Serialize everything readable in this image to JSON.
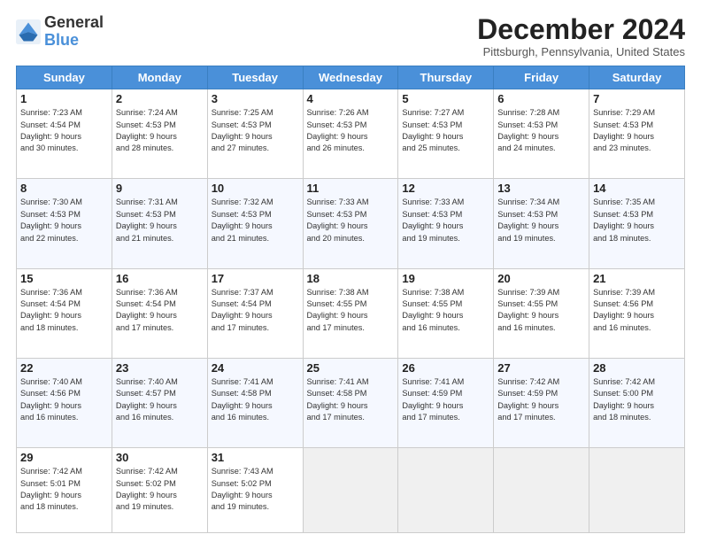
{
  "logo": {
    "text1": "General",
    "text2": "Blue"
  },
  "title": "December 2024",
  "location": "Pittsburgh, Pennsylvania, United States",
  "days_of_week": [
    "Sunday",
    "Monday",
    "Tuesday",
    "Wednesday",
    "Thursday",
    "Friday",
    "Saturday"
  ],
  "weeks": [
    [
      {
        "day": "1",
        "info": "Sunrise: 7:23 AM\nSunset: 4:54 PM\nDaylight: 9 hours\nand 30 minutes."
      },
      {
        "day": "2",
        "info": "Sunrise: 7:24 AM\nSunset: 4:53 PM\nDaylight: 9 hours\nand 28 minutes."
      },
      {
        "day": "3",
        "info": "Sunrise: 7:25 AM\nSunset: 4:53 PM\nDaylight: 9 hours\nand 27 minutes."
      },
      {
        "day": "4",
        "info": "Sunrise: 7:26 AM\nSunset: 4:53 PM\nDaylight: 9 hours\nand 26 minutes."
      },
      {
        "day": "5",
        "info": "Sunrise: 7:27 AM\nSunset: 4:53 PM\nDaylight: 9 hours\nand 25 minutes."
      },
      {
        "day": "6",
        "info": "Sunrise: 7:28 AM\nSunset: 4:53 PM\nDaylight: 9 hours\nand 24 minutes."
      },
      {
        "day": "7",
        "info": "Sunrise: 7:29 AM\nSunset: 4:53 PM\nDaylight: 9 hours\nand 23 minutes."
      }
    ],
    [
      {
        "day": "8",
        "info": "Sunrise: 7:30 AM\nSunset: 4:53 PM\nDaylight: 9 hours\nand 22 minutes."
      },
      {
        "day": "9",
        "info": "Sunrise: 7:31 AM\nSunset: 4:53 PM\nDaylight: 9 hours\nand 21 minutes."
      },
      {
        "day": "10",
        "info": "Sunrise: 7:32 AM\nSunset: 4:53 PM\nDaylight: 9 hours\nand 21 minutes."
      },
      {
        "day": "11",
        "info": "Sunrise: 7:33 AM\nSunset: 4:53 PM\nDaylight: 9 hours\nand 20 minutes."
      },
      {
        "day": "12",
        "info": "Sunrise: 7:33 AM\nSunset: 4:53 PM\nDaylight: 9 hours\nand 19 minutes."
      },
      {
        "day": "13",
        "info": "Sunrise: 7:34 AM\nSunset: 4:53 PM\nDaylight: 9 hours\nand 19 minutes."
      },
      {
        "day": "14",
        "info": "Sunrise: 7:35 AM\nSunset: 4:53 PM\nDaylight: 9 hours\nand 18 minutes."
      }
    ],
    [
      {
        "day": "15",
        "info": "Sunrise: 7:36 AM\nSunset: 4:54 PM\nDaylight: 9 hours\nand 18 minutes."
      },
      {
        "day": "16",
        "info": "Sunrise: 7:36 AM\nSunset: 4:54 PM\nDaylight: 9 hours\nand 17 minutes."
      },
      {
        "day": "17",
        "info": "Sunrise: 7:37 AM\nSunset: 4:54 PM\nDaylight: 9 hours\nand 17 minutes."
      },
      {
        "day": "18",
        "info": "Sunrise: 7:38 AM\nSunset: 4:55 PM\nDaylight: 9 hours\nand 17 minutes."
      },
      {
        "day": "19",
        "info": "Sunrise: 7:38 AM\nSunset: 4:55 PM\nDaylight: 9 hours\nand 16 minutes."
      },
      {
        "day": "20",
        "info": "Sunrise: 7:39 AM\nSunset: 4:55 PM\nDaylight: 9 hours\nand 16 minutes."
      },
      {
        "day": "21",
        "info": "Sunrise: 7:39 AM\nSunset: 4:56 PM\nDaylight: 9 hours\nand 16 minutes."
      }
    ],
    [
      {
        "day": "22",
        "info": "Sunrise: 7:40 AM\nSunset: 4:56 PM\nDaylight: 9 hours\nand 16 minutes."
      },
      {
        "day": "23",
        "info": "Sunrise: 7:40 AM\nSunset: 4:57 PM\nDaylight: 9 hours\nand 16 minutes."
      },
      {
        "day": "24",
        "info": "Sunrise: 7:41 AM\nSunset: 4:58 PM\nDaylight: 9 hours\nand 16 minutes."
      },
      {
        "day": "25",
        "info": "Sunrise: 7:41 AM\nSunset: 4:58 PM\nDaylight: 9 hours\nand 17 minutes."
      },
      {
        "day": "26",
        "info": "Sunrise: 7:41 AM\nSunset: 4:59 PM\nDaylight: 9 hours\nand 17 minutes."
      },
      {
        "day": "27",
        "info": "Sunrise: 7:42 AM\nSunset: 4:59 PM\nDaylight: 9 hours\nand 17 minutes."
      },
      {
        "day": "28",
        "info": "Sunrise: 7:42 AM\nSunset: 5:00 PM\nDaylight: 9 hours\nand 18 minutes."
      }
    ],
    [
      {
        "day": "29",
        "info": "Sunrise: 7:42 AM\nSunset: 5:01 PM\nDaylight: 9 hours\nand 18 minutes."
      },
      {
        "day": "30",
        "info": "Sunrise: 7:42 AM\nSunset: 5:02 PM\nDaylight: 9 hours\nand 19 minutes."
      },
      {
        "day": "31",
        "info": "Sunrise: 7:43 AM\nSunset: 5:02 PM\nDaylight: 9 hours\nand 19 minutes."
      },
      null,
      null,
      null,
      null
    ]
  ]
}
